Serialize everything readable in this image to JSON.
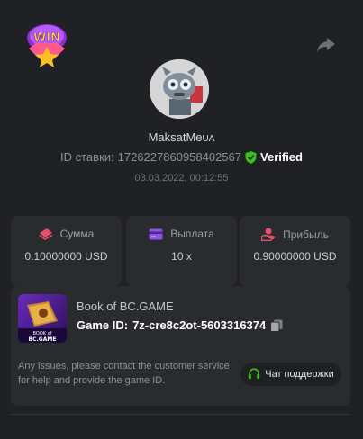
{
  "header": {
    "win_badge_text": "WIN",
    "share_icon": "share-icon"
  },
  "profile": {
    "username": "MaksatMe",
    "username_suffix": "UA",
    "bet_id_label": "ID ставки:",
    "bet_id_value": "1726227860958402567",
    "verified_label": "Verified",
    "datetime": "03.03.2022, 00:12:55"
  },
  "stats": [
    {
      "icon": "money-stack-icon",
      "label": "Сумма",
      "value": "0.10000000 USD",
      "icon_color": "#e84f6a"
    },
    {
      "icon": "wallet-card-icon",
      "label": "Выплата",
      "value": "10 x",
      "icon_color": "#8a52e6"
    },
    {
      "icon": "hand-coin-icon",
      "label": "Прибыль",
      "value": "0.90000000 USD",
      "icon_color": "#e84f6a"
    }
  ],
  "game": {
    "name": "Book of BC.GAME",
    "id_label": "Game ID:",
    "id_value": "7z-cre8c2ot-5603316374",
    "thumb_text_top": "BOOK of",
    "thumb_text_bottom": "BC.GAME",
    "help_text": "Any issues, please contact the customer service for help and provide the game ID.",
    "support_label": "Чат поддержки"
  },
  "colors": {
    "verified": "#3bc117",
    "accent_red": "#e84f6a",
    "accent_purple": "#8a52e6",
    "support_icon": "#3bc117"
  }
}
